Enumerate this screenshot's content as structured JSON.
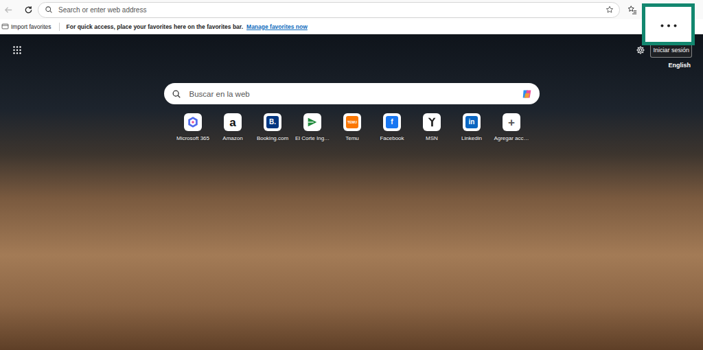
{
  "browser": {
    "back_enabled": false,
    "address_bar": {
      "placeholder": "Search or enter web address"
    },
    "menu_button": {
      "highlighted": true
    }
  },
  "favorites_bar": {
    "import_label": "Import favorites",
    "hint": "For quick access, place your favorites here on the favorites bar.",
    "link": "Manage favorites now"
  },
  "page": {
    "sign_in": "Iniciar sesión",
    "language": "English",
    "search": {
      "placeholder": "Buscar en la web"
    },
    "quick_links": [
      {
        "label": "Microsoft 365",
        "kind": "ring",
        "color": "#4f6bed"
      },
      {
        "label": "Amazon",
        "kind": "letter",
        "glyph": "a",
        "color": "#111111"
      },
      {
        "label": "Booking.com",
        "kind": "square",
        "glyph": "B.",
        "color": "#003580"
      },
      {
        "label": "El Corte Ing…",
        "kind": "triangle",
        "color": "#1f8a3b"
      },
      {
        "label": "Temu",
        "kind": "square",
        "glyph": "TEMU",
        "color": "#fb7701"
      },
      {
        "label": "Facebook",
        "kind": "square",
        "glyph": "f",
        "color": "#1877f2"
      },
      {
        "label": "MSN",
        "kind": "fold",
        "color": "#222222"
      },
      {
        "label": "Linkedin",
        "kind": "square",
        "glyph": "in",
        "color": "#0a66c2"
      },
      {
        "label": "Agregar acc…",
        "kind": "letter",
        "glyph": "+",
        "color": "#555555"
      }
    ]
  }
}
